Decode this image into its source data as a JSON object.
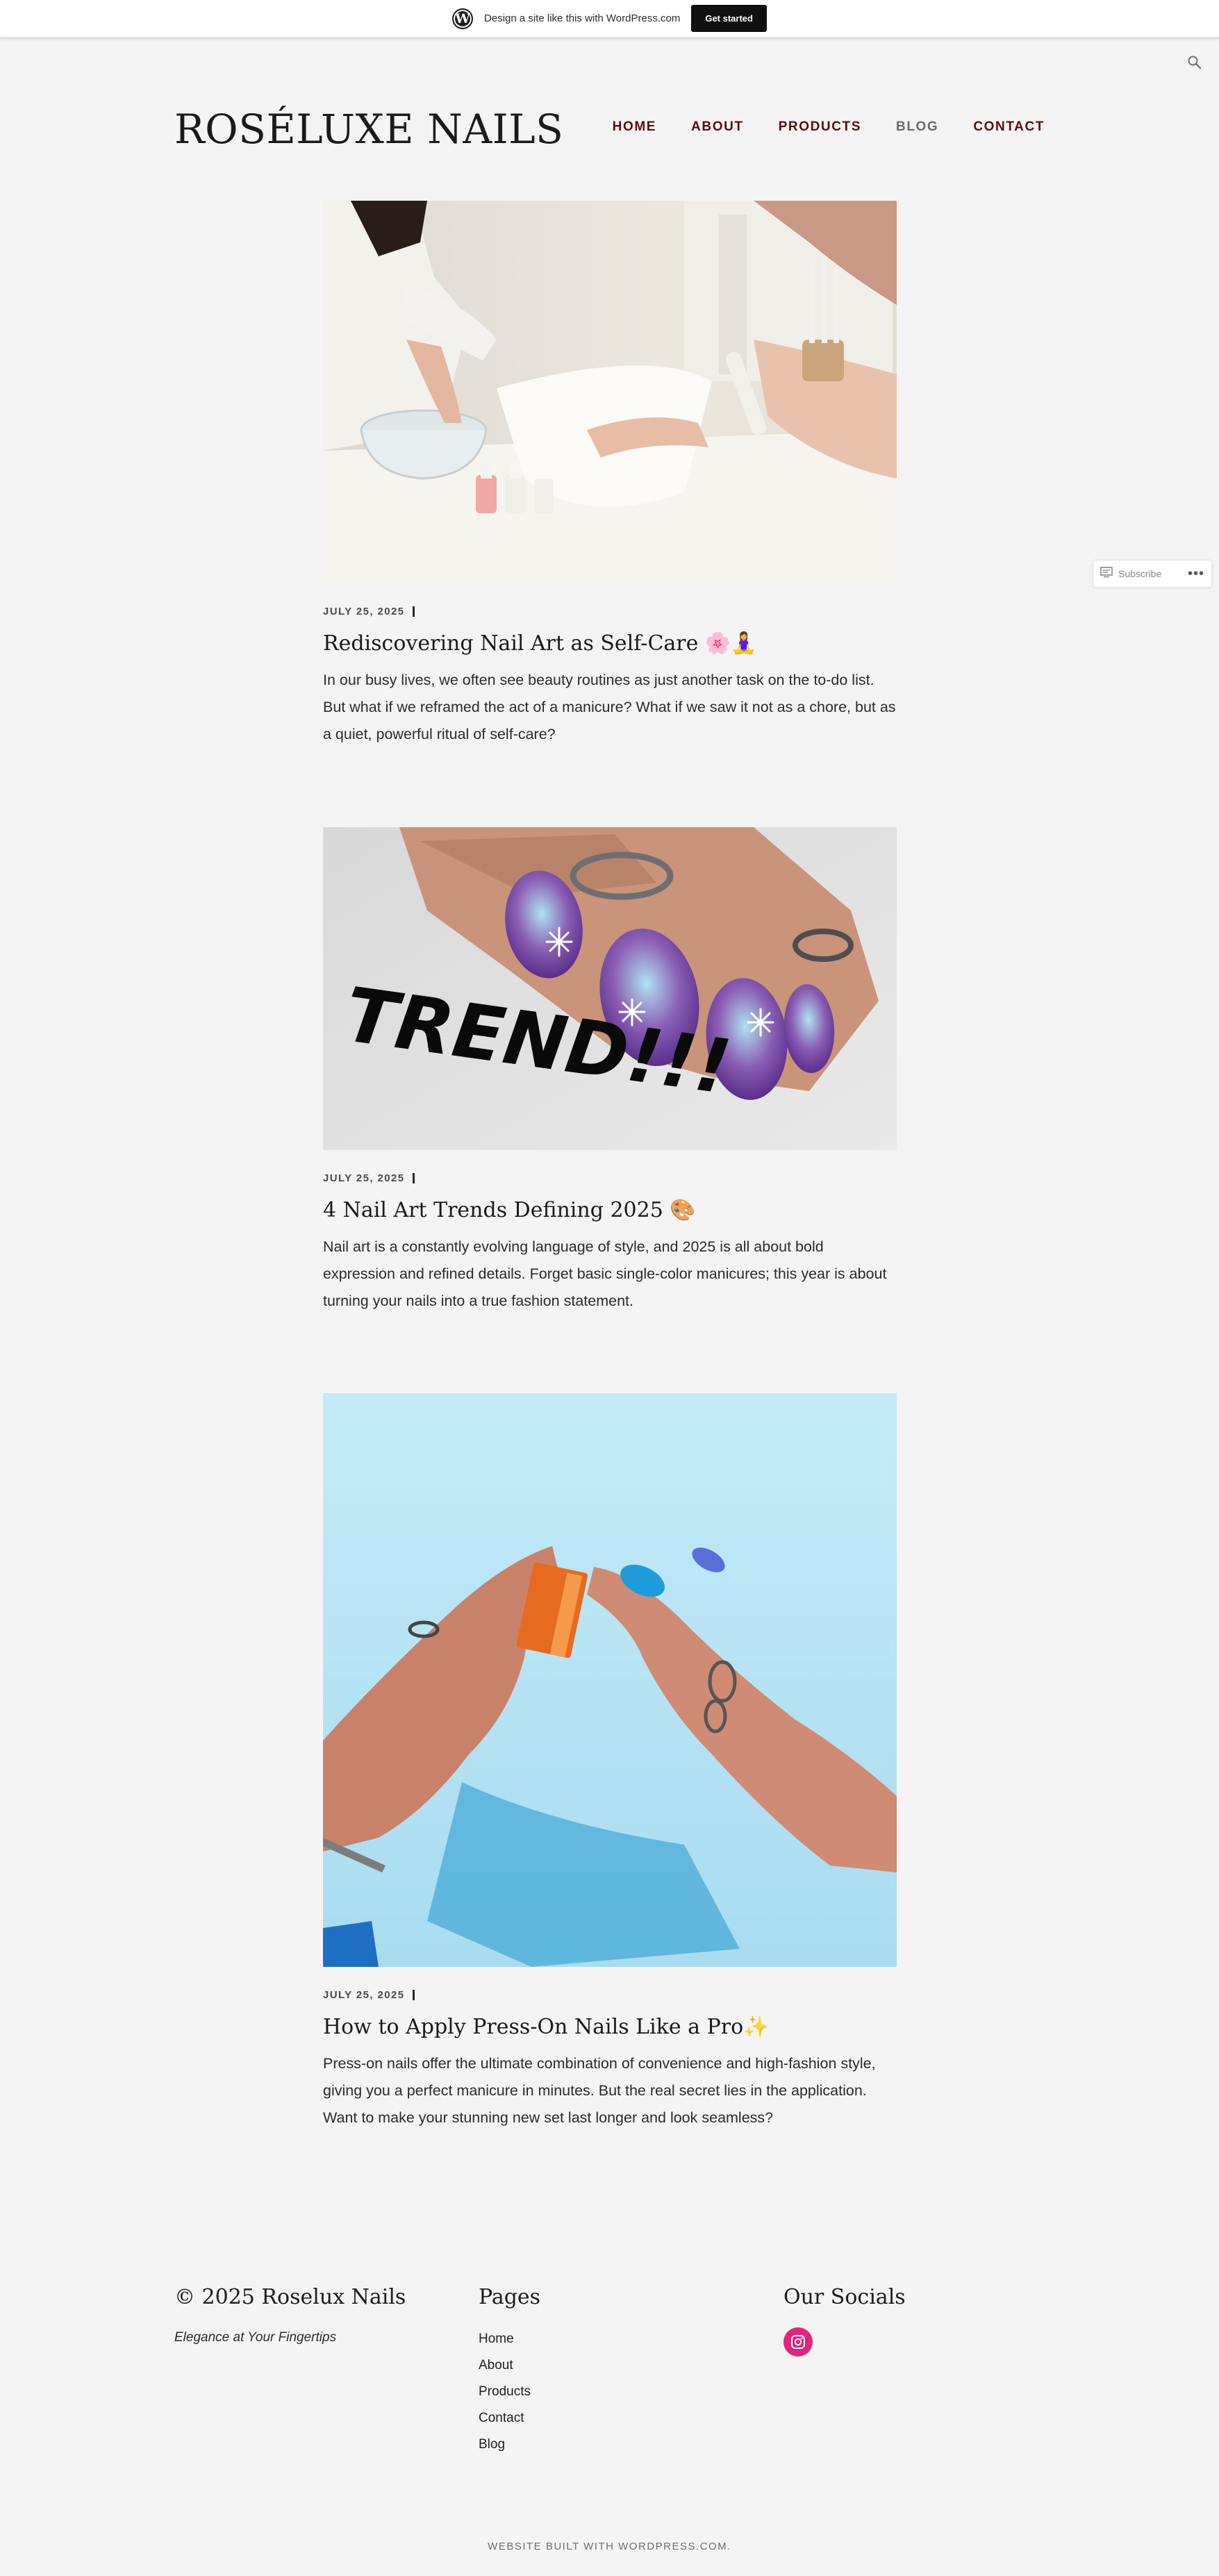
{
  "wp_banner": {
    "text": "Design a site like this with WordPress.com",
    "button_label": "Get started",
    "logo_letter": "W"
  },
  "header": {
    "site_title": "ROSÉLUXE NAILS",
    "nav": [
      {
        "label": "HOME"
      },
      {
        "label": "ABOUT"
      },
      {
        "label": "PRODUCTS"
      },
      {
        "label": "BLOG",
        "current": true
      },
      {
        "label": "CONTACT"
      }
    ],
    "search_icon": "search-icon"
  },
  "posts": [
    {
      "date": "JULY 25, 2025",
      "title": "Rediscovering Nail Art as Self-Care 🌸🧘‍♀️",
      "excerpt": "In our busy lives, we often see beauty routines as just another task on the to-do list. But what if we reframed the act of a manicure? What if we saw it not as a chore, but as a quiet, powerful ritual of self-care?",
      "image_subject": "manicure at salon table"
    },
    {
      "date": "JULY 25, 2025",
      "title": "4 Nail Art Trends Defining 2025 🎨",
      "excerpt": "Nail art is a constantly evolving language of style, and 2025 is all about bold expression and refined details. Forget basic single-color manicures; this year is about turning your nails into a true fashion statement.",
      "image_caption": "TREND!!!"
    },
    {
      "date": "JULY 25, 2025",
      "title": "How to Apply Press-On Nails Like a Pro✨",
      "excerpt": "Press-on nails offer the ultimate combination of convenience and high-fashion style, giving you a perfect manicure in minutes. But the real secret lies in the application. Want to make your stunning new set last longer and look seamless?",
      "image_subject": "hands with blue press-on nails"
    }
  ],
  "subscribe": {
    "label": "Subscribe",
    "more": "•••"
  },
  "footer": {
    "copyright": "© 2025 Roselux Nails",
    "tagline": "Elegance at Your Fingertips",
    "pages_heading": "Pages",
    "pages": [
      {
        "label": "Home"
      },
      {
        "label": "About"
      },
      {
        "label": "Products"
      },
      {
        "label": "Contact"
      },
      {
        "label": "Blog"
      }
    ],
    "socials_heading": "Our Socials",
    "instagram_icon": "instagram-icon",
    "credit": "WEBSITE BUILT WITH WORDPRESS.COM."
  },
  "colors": {
    "nav_link": "#5e0b0b",
    "nav_current": "#6a6a6a",
    "instagram": "#e2237f",
    "page_bg": "#f4f4f4"
  }
}
